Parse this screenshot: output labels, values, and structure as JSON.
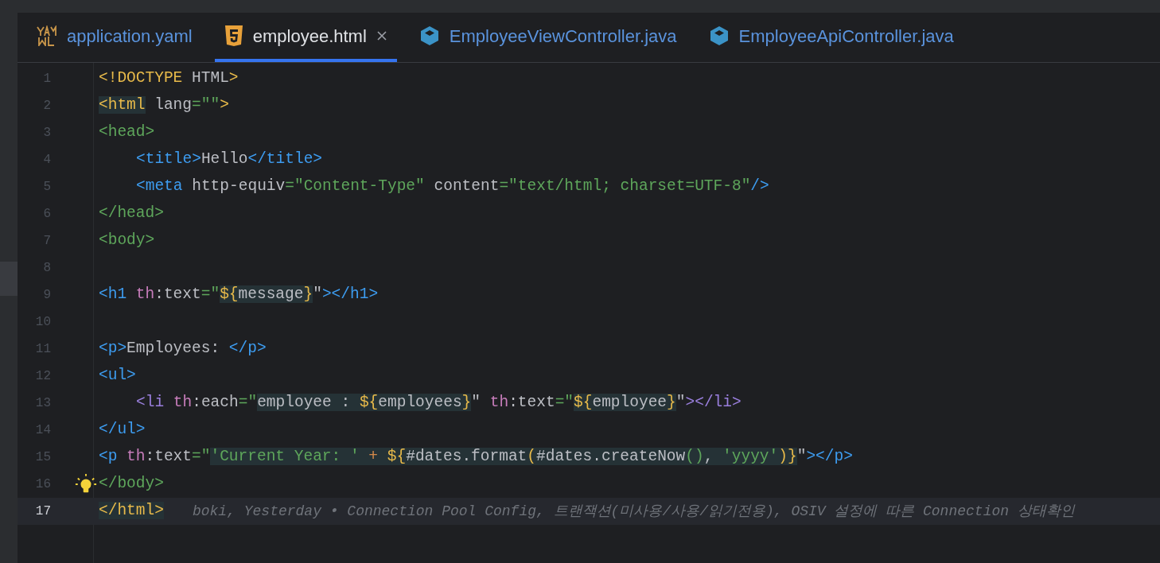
{
  "tabs": [
    {
      "label": "application.yaml",
      "kind": "yaml",
      "selected": false,
      "closable": false
    },
    {
      "label": "employee.html",
      "kind": "html",
      "selected": true,
      "closable": true
    },
    {
      "label": "EmployeeViewController.java",
      "kind": "java",
      "selected": false,
      "closable": false
    },
    {
      "label": "EmployeeApiController.java",
      "kind": "java",
      "selected": false,
      "closable": false
    }
  ],
  "editor": {
    "lines": [
      {
        "number": "1",
        "current": false,
        "indented": false,
        "bulb": false,
        "tokens": [
          {
            "kind": "yellow",
            "text": "<!DOCTYPE"
          },
          {
            "kind": "plain",
            "text": " HTML"
          },
          {
            "kind": "yellow",
            "text": ">"
          }
        ]
      },
      {
        "number": "2",
        "current": false,
        "indented": false,
        "bulb": false,
        "tokens": [
          {
            "kind": "match",
            "children": [
              {
                "kind": "yellow",
                "text": "<html"
              }
            ]
          },
          {
            "kind": "plain",
            "text": " lang"
          },
          {
            "kind": "green",
            "text": "=\"\""
          },
          {
            "kind": "yellow",
            "text": ">"
          }
        ]
      },
      {
        "number": "3",
        "current": false,
        "indented": false,
        "bulb": false,
        "tokens": [
          {
            "kind": "green",
            "text": "<head>"
          }
        ]
      },
      {
        "number": "4",
        "current": false,
        "indented": true,
        "bulb": false,
        "tokens": [
          {
            "kind": "blue",
            "text": "<title>"
          },
          {
            "kind": "plain",
            "text": "Hello"
          },
          {
            "kind": "blue",
            "text": "</title>"
          }
        ]
      },
      {
        "number": "5",
        "current": false,
        "indented": true,
        "bulb": false,
        "tokens": [
          {
            "kind": "blue",
            "text": "<meta"
          },
          {
            "kind": "plain",
            "text": " http-equiv"
          },
          {
            "kind": "green",
            "text": "=\"Content-Type\""
          },
          {
            "kind": "plain",
            "text": " content"
          },
          {
            "kind": "green",
            "text": "=\"text/html; charset=UTF-8\""
          },
          {
            "kind": "blue",
            "text": "/>"
          }
        ]
      },
      {
        "number": "6",
        "current": false,
        "indented": false,
        "bulb": false,
        "tokens": [
          {
            "kind": "green",
            "text": "</head>"
          }
        ]
      },
      {
        "number": "7",
        "current": false,
        "indented": false,
        "bulb": false,
        "tokens": [
          {
            "kind": "green",
            "text": "<body>"
          }
        ]
      },
      {
        "number": "8",
        "current": false,
        "bulb": false
      },
      {
        "number": "9",
        "current": false,
        "indented": false,
        "bulb": false,
        "tokens": [
          {
            "kind": "blue",
            "text": "<h1"
          },
          {
            "kind": "pink",
            "text": " th"
          },
          {
            "kind": "plain",
            "text": ":text"
          },
          {
            "kind": "green",
            "text": "=\""
          },
          {
            "kind": "match",
            "children": [
              {
                "kind": "yellow",
                "text": "${"
              },
              {
                "kind": "plain",
                "text": "message"
              },
              {
                "kind": "yellow",
                "text": "}"
              }
            ]
          },
          {
            "kind": "plain",
            "text": "\""
          },
          {
            "kind": "blue",
            "text": "></h1>"
          }
        ]
      },
      {
        "number": "10",
        "current": false,
        "bulb": false
      },
      {
        "number": "11",
        "current": false,
        "indented": false,
        "bulb": false,
        "tokens": [
          {
            "kind": "blue",
            "text": "<p>"
          },
          {
            "kind": "plain",
            "text": "Employees: "
          },
          {
            "kind": "blue",
            "text": "</p>"
          }
        ]
      },
      {
        "number": "12",
        "current": false,
        "indented": false,
        "bulb": false,
        "tokens": [
          {
            "kind": "blue",
            "text": "<ul>"
          }
        ]
      },
      {
        "number": "13",
        "current": false,
        "indented": true,
        "bulb": false,
        "tokens": [
          {
            "kind": "purple",
            "text": "<li"
          },
          {
            "kind": "pink",
            "text": " th"
          },
          {
            "kind": "plain",
            "text": ":each"
          },
          {
            "kind": "green",
            "text": "=\""
          },
          {
            "kind": "match",
            "children": [
              {
                "kind": "plain",
                "text": "employee : "
              },
              {
                "kind": "yellow",
                "text": "${"
              },
              {
                "kind": "plain",
                "text": "employees"
              },
              {
                "kind": "yellow",
                "text": "}"
              }
            ]
          },
          {
            "kind": "plain",
            "text": "\" "
          },
          {
            "kind": "pink",
            "text": "th"
          },
          {
            "kind": "plain",
            "text": ":text"
          },
          {
            "kind": "green",
            "text": "=\""
          },
          {
            "kind": "match",
            "children": [
              {
                "kind": "yellow",
                "text": "${"
              },
              {
                "kind": "plain",
                "text": "employee"
              },
              {
                "kind": "yellow",
                "text": "}"
              }
            ]
          },
          {
            "kind": "plain",
            "text": "\""
          },
          {
            "kind": "purple",
            "text": "></li>"
          }
        ]
      },
      {
        "number": "14",
        "current": false,
        "indented": false,
        "bulb": false,
        "tokens": [
          {
            "kind": "blue",
            "text": "</ul>"
          }
        ]
      },
      {
        "number": "15",
        "current": false,
        "indented": false,
        "bulb": false,
        "tokens": [
          {
            "kind": "blue",
            "text": "<p"
          },
          {
            "kind": "pink",
            "text": " th"
          },
          {
            "kind": "plain",
            "text": ":text"
          },
          {
            "kind": "green",
            "text": "=\""
          },
          {
            "kind": "match",
            "children": [
              {
                "kind": "green",
                "text": "'Current Year: '"
              },
              {
                "kind": "orange",
                "text": " + "
              },
              {
                "kind": "yellow",
                "text": "${"
              },
              {
                "kind": "plain",
                "text": "#dates.format"
              },
              {
                "kind": "yellow",
                "text": "("
              },
              {
                "kind": "plain",
                "text": "#dates.createNow"
              },
              {
                "kind": "green",
                "text": "()"
              },
              {
                "kind": "plain",
                "text": ", "
              },
              {
                "kind": "green",
                "text": "'yyyy'"
              },
              {
                "kind": "yellow",
                "text": ")}"
              }
            ]
          },
          {
            "kind": "plain",
            "text": "\""
          },
          {
            "kind": "blue",
            "text": "></p>"
          }
        ]
      },
      {
        "number": "16",
        "current": false,
        "indented": false,
        "bulb": true,
        "tokens": [
          {
            "kind": "green",
            "text": "</body>"
          }
        ]
      },
      {
        "number": "17",
        "current": true,
        "indented": false,
        "bulb": false,
        "tokens": [
          {
            "kind": "match",
            "children": [
              {
                "kind": "yellow",
                "text": "</html>"
              }
            ]
          }
        ],
        "annotation": "boki, Yesterday • Connection Pool Config, 트랜잭션(미사용/사용/읽기전용), OSIV 설정에 따른 Connection 상태확인"
      }
    ]
  }
}
